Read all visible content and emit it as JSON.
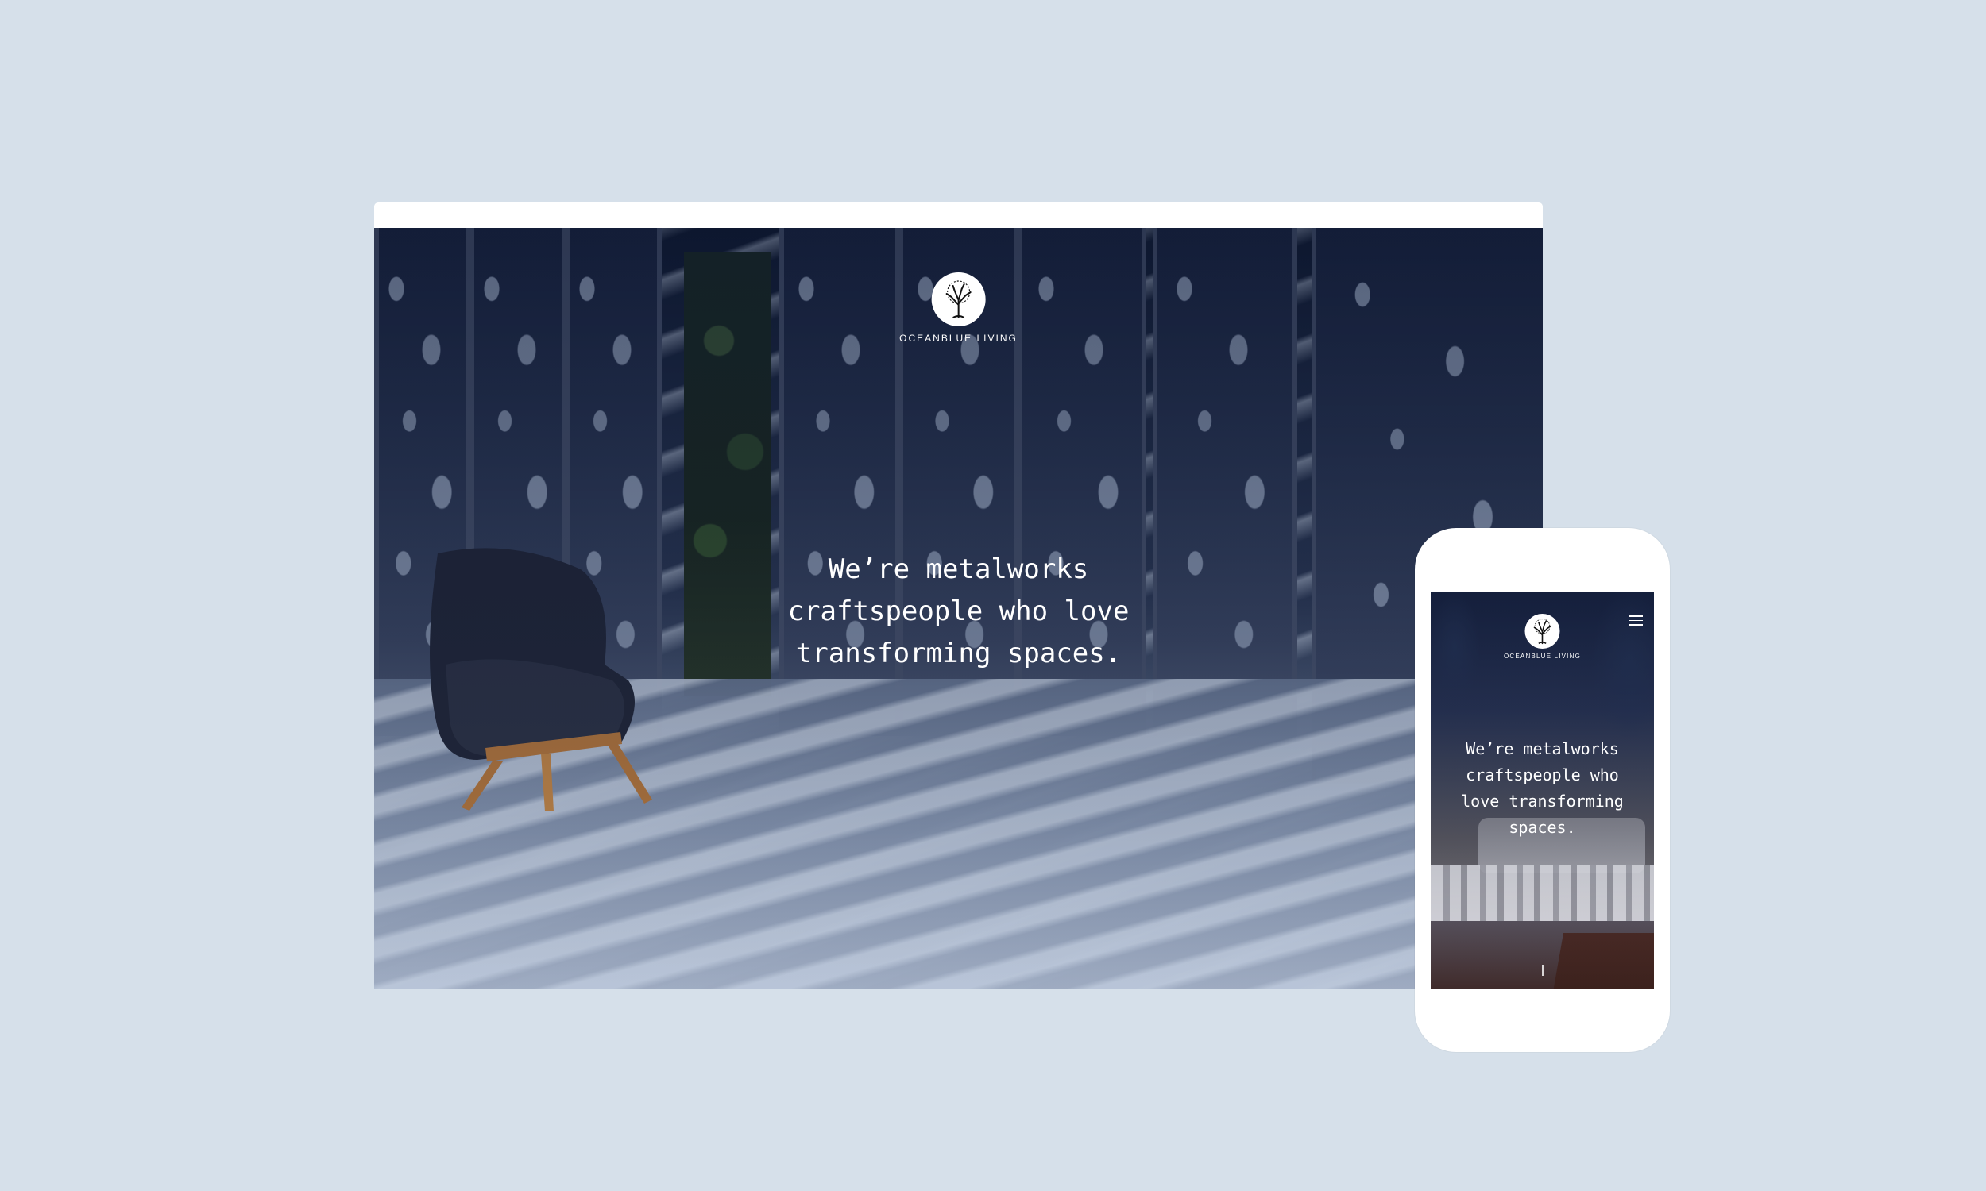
{
  "brand": {
    "name": "OCEANBLUE LIVING",
    "logo_icon": "tree-logo-icon"
  },
  "hero": {
    "headline": "We’re metalworks\ncraftspeople who love\ntransforming spaces."
  },
  "mobile": {
    "headline": "We’re metalworks\ncraftspeople who\nlove transforming\nspaces.",
    "menu_icon": "hamburger-menu-icon"
  },
  "colors": {
    "background": "#d6e0ea",
    "frame": "#ffffff",
    "text": "#ffffff"
  }
}
